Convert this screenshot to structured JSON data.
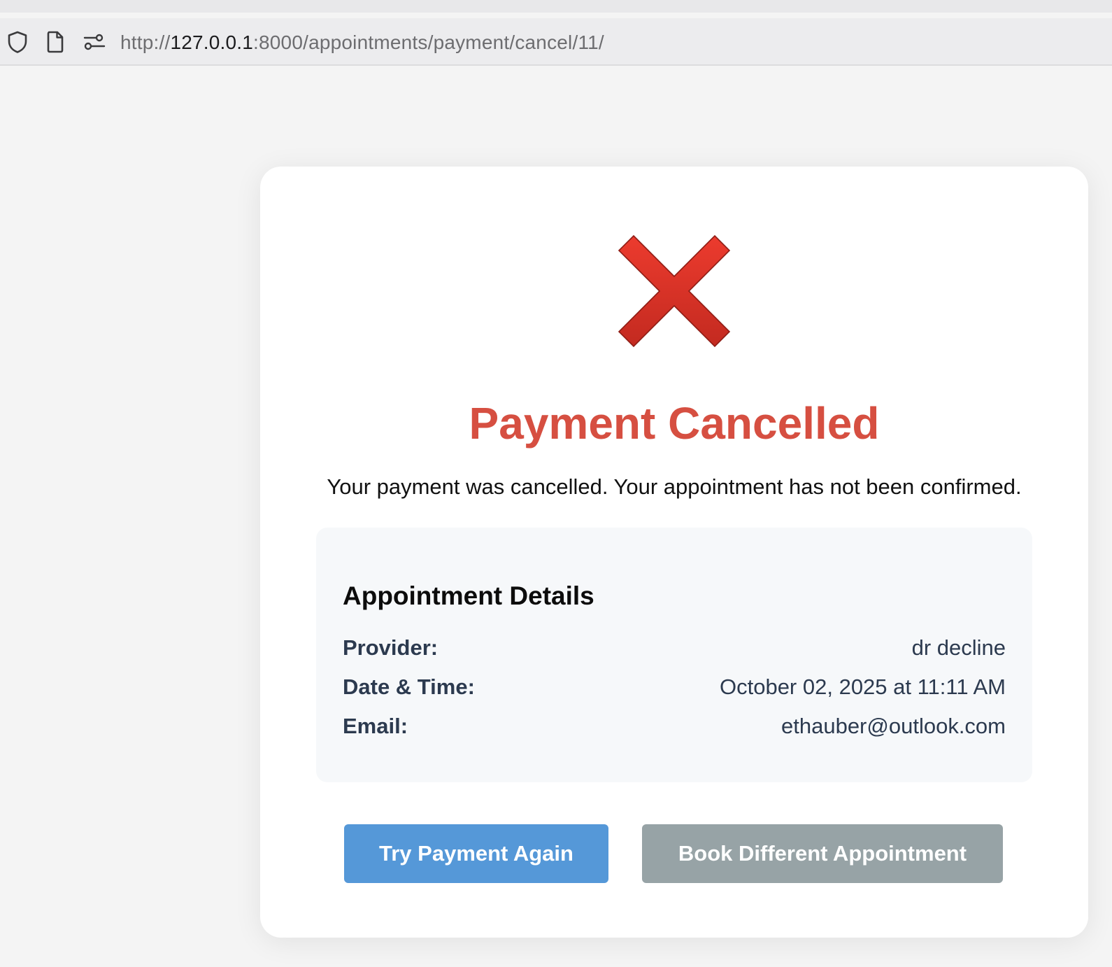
{
  "browser": {
    "url_scheme": "http://",
    "url_host": "127.0.0.1",
    "url_rest": ":8000/appointments/payment/cancel/11/"
  },
  "page": {
    "icon": "cross-mark-icon",
    "title": "Payment Cancelled",
    "message": "Your payment was cancelled. Your appointment has not been confirmed.",
    "title_color": "#d64f41"
  },
  "details": {
    "heading": "Appointment Details",
    "rows": [
      {
        "label": "Provider:",
        "value": "dr decline"
      },
      {
        "label": "Date & Time:",
        "value": "October 02, 2025 at 11:11 AM"
      },
      {
        "label": "Email:",
        "value": "ethauber@outlook.com"
      }
    ]
  },
  "actions": {
    "retry_label": "Try Payment Again",
    "retry_color": "#5598d8",
    "book_label": "Book Different Appointment",
    "book_color": "#97a3a6"
  }
}
